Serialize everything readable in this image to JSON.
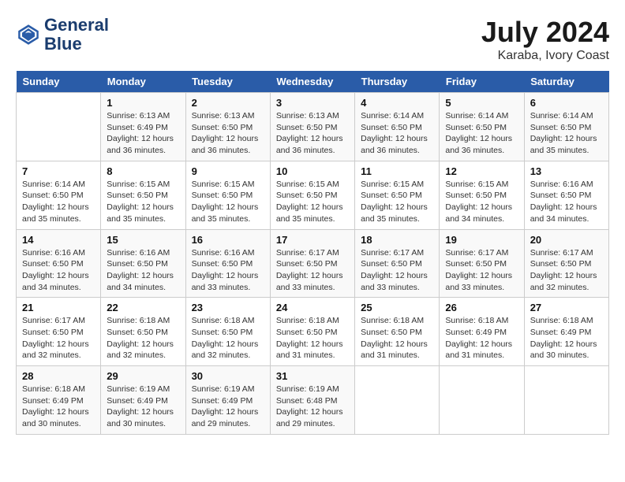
{
  "header": {
    "logo_line1": "General",
    "logo_line2": "Blue",
    "month_year": "July 2024",
    "location": "Karaba, Ivory Coast"
  },
  "days_of_week": [
    "Sunday",
    "Monday",
    "Tuesday",
    "Wednesday",
    "Thursday",
    "Friday",
    "Saturday"
  ],
  "weeks": [
    [
      {
        "day": "",
        "info": ""
      },
      {
        "day": "1",
        "info": "Sunrise: 6:13 AM\nSunset: 6:49 PM\nDaylight: 12 hours\nand 36 minutes."
      },
      {
        "day": "2",
        "info": "Sunrise: 6:13 AM\nSunset: 6:50 PM\nDaylight: 12 hours\nand 36 minutes."
      },
      {
        "day": "3",
        "info": "Sunrise: 6:13 AM\nSunset: 6:50 PM\nDaylight: 12 hours\nand 36 minutes."
      },
      {
        "day": "4",
        "info": "Sunrise: 6:14 AM\nSunset: 6:50 PM\nDaylight: 12 hours\nand 36 minutes."
      },
      {
        "day": "5",
        "info": "Sunrise: 6:14 AM\nSunset: 6:50 PM\nDaylight: 12 hours\nand 36 minutes."
      },
      {
        "day": "6",
        "info": "Sunrise: 6:14 AM\nSunset: 6:50 PM\nDaylight: 12 hours\nand 35 minutes."
      }
    ],
    [
      {
        "day": "7",
        "info": "Sunrise: 6:14 AM\nSunset: 6:50 PM\nDaylight: 12 hours\nand 35 minutes."
      },
      {
        "day": "8",
        "info": "Sunrise: 6:15 AM\nSunset: 6:50 PM\nDaylight: 12 hours\nand 35 minutes."
      },
      {
        "day": "9",
        "info": "Sunrise: 6:15 AM\nSunset: 6:50 PM\nDaylight: 12 hours\nand 35 minutes."
      },
      {
        "day": "10",
        "info": "Sunrise: 6:15 AM\nSunset: 6:50 PM\nDaylight: 12 hours\nand 35 minutes."
      },
      {
        "day": "11",
        "info": "Sunrise: 6:15 AM\nSunset: 6:50 PM\nDaylight: 12 hours\nand 35 minutes."
      },
      {
        "day": "12",
        "info": "Sunrise: 6:15 AM\nSunset: 6:50 PM\nDaylight: 12 hours\nand 34 minutes."
      },
      {
        "day": "13",
        "info": "Sunrise: 6:16 AM\nSunset: 6:50 PM\nDaylight: 12 hours\nand 34 minutes."
      }
    ],
    [
      {
        "day": "14",
        "info": "Sunrise: 6:16 AM\nSunset: 6:50 PM\nDaylight: 12 hours\nand 34 minutes."
      },
      {
        "day": "15",
        "info": "Sunrise: 6:16 AM\nSunset: 6:50 PM\nDaylight: 12 hours\nand 34 minutes."
      },
      {
        "day": "16",
        "info": "Sunrise: 6:16 AM\nSunset: 6:50 PM\nDaylight: 12 hours\nand 33 minutes."
      },
      {
        "day": "17",
        "info": "Sunrise: 6:17 AM\nSunset: 6:50 PM\nDaylight: 12 hours\nand 33 minutes."
      },
      {
        "day": "18",
        "info": "Sunrise: 6:17 AM\nSunset: 6:50 PM\nDaylight: 12 hours\nand 33 minutes."
      },
      {
        "day": "19",
        "info": "Sunrise: 6:17 AM\nSunset: 6:50 PM\nDaylight: 12 hours\nand 33 minutes."
      },
      {
        "day": "20",
        "info": "Sunrise: 6:17 AM\nSunset: 6:50 PM\nDaylight: 12 hours\nand 32 minutes."
      }
    ],
    [
      {
        "day": "21",
        "info": "Sunrise: 6:17 AM\nSunset: 6:50 PM\nDaylight: 12 hours\nand 32 minutes."
      },
      {
        "day": "22",
        "info": "Sunrise: 6:18 AM\nSunset: 6:50 PM\nDaylight: 12 hours\nand 32 minutes."
      },
      {
        "day": "23",
        "info": "Sunrise: 6:18 AM\nSunset: 6:50 PM\nDaylight: 12 hours\nand 32 minutes."
      },
      {
        "day": "24",
        "info": "Sunrise: 6:18 AM\nSunset: 6:50 PM\nDaylight: 12 hours\nand 31 minutes."
      },
      {
        "day": "25",
        "info": "Sunrise: 6:18 AM\nSunset: 6:50 PM\nDaylight: 12 hours\nand 31 minutes."
      },
      {
        "day": "26",
        "info": "Sunrise: 6:18 AM\nSunset: 6:49 PM\nDaylight: 12 hours\nand 31 minutes."
      },
      {
        "day": "27",
        "info": "Sunrise: 6:18 AM\nSunset: 6:49 PM\nDaylight: 12 hours\nand 30 minutes."
      }
    ],
    [
      {
        "day": "28",
        "info": "Sunrise: 6:18 AM\nSunset: 6:49 PM\nDaylight: 12 hours\nand 30 minutes."
      },
      {
        "day": "29",
        "info": "Sunrise: 6:19 AM\nSunset: 6:49 PM\nDaylight: 12 hours\nand 30 minutes."
      },
      {
        "day": "30",
        "info": "Sunrise: 6:19 AM\nSunset: 6:49 PM\nDaylight: 12 hours\nand 29 minutes."
      },
      {
        "day": "31",
        "info": "Sunrise: 6:19 AM\nSunset: 6:48 PM\nDaylight: 12 hours\nand 29 minutes."
      },
      {
        "day": "",
        "info": ""
      },
      {
        "day": "",
        "info": ""
      },
      {
        "day": "",
        "info": ""
      }
    ]
  ]
}
